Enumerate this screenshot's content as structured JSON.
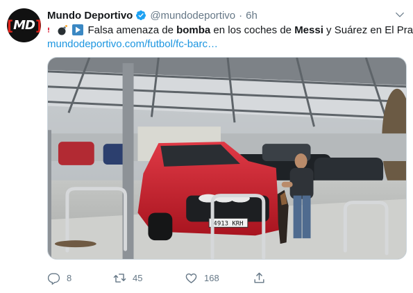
{
  "author": {
    "avatar_text": "MD",
    "name": "Mundo Deportivo",
    "handle": "@mundodeportivo",
    "separator": "·",
    "time": "6h"
  },
  "tweet": {
    "t1": "Falsa amenaza de ",
    "t2": "bomba",
    "t3": " en los coches de ",
    "t4": "Messi",
    "t5": " y Suárez en El Prat",
    "link": "mundodeportivo.com/futbol/fc-barc…"
  },
  "media": {
    "plate": "4913 KRH"
  },
  "actions": {
    "replies": "8",
    "retweets": "45",
    "likes": "168"
  },
  "icons": {
    "verified": "verified-badge-icon",
    "caret": "chevron-down-icon",
    "reply": "reply-icon",
    "retweet": "retweet-icon",
    "like": "heart-icon",
    "share": "share-icon"
  },
  "colors": {
    "accent": "#1da1f2",
    "link": "#1b95e0",
    "muted": "#657786",
    "brand_red": "#e2231a"
  }
}
